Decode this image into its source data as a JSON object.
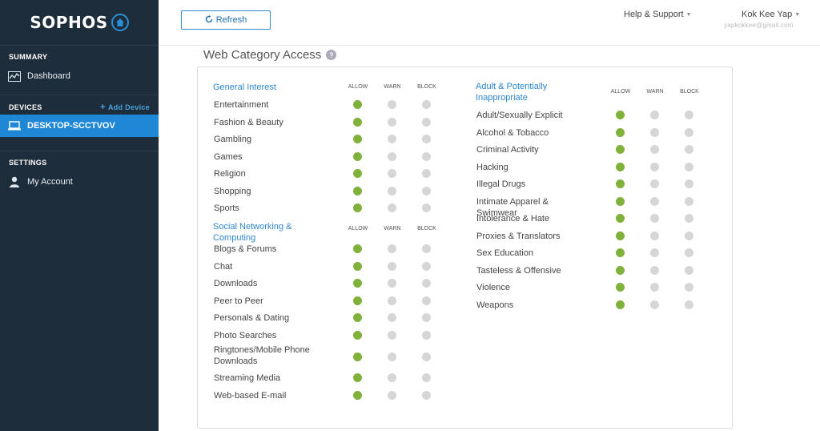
{
  "brand": {
    "name": "SOPHOS"
  },
  "sidebar": {
    "summary_heading": "SUMMARY",
    "dashboard": "Dashboard",
    "devices_heading": "DEVICES",
    "add_device": "Add Device",
    "device": "DESKTOP-SCCTVOV",
    "settings_heading": "SETTINGS",
    "my_account": "My Account"
  },
  "header": {
    "refresh": "Refresh",
    "help": "Help & Support",
    "user": "Kok Kee Yap",
    "email": "yapkokkee@gmail.com"
  },
  "page": {
    "title": "Web Category Access"
  },
  "columns": {
    "allow": "ALLOW",
    "warn": "WARN",
    "block": "BLOCK"
  },
  "groups": [
    {
      "title": "General Interest",
      "items": [
        {
          "label": "Entertainment",
          "setting": "allow"
        },
        {
          "label": "Fashion & Beauty",
          "setting": "allow"
        },
        {
          "label": "Gambling",
          "setting": "allow"
        },
        {
          "label": "Games",
          "setting": "allow"
        },
        {
          "label": "Religion",
          "setting": "allow"
        },
        {
          "label": "Shopping",
          "setting": "allow"
        },
        {
          "label": "Sports",
          "setting": "allow"
        }
      ]
    },
    {
      "title": "Social Networking & Computing",
      "items": [
        {
          "label": "Blogs & Forums",
          "setting": "allow"
        },
        {
          "label": "Chat",
          "setting": "allow"
        },
        {
          "label": "Downloads",
          "setting": "allow"
        },
        {
          "label": "Peer to Peer",
          "setting": "allow"
        },
        {
          "label": "Personals & Dating",
          "setting": "allow"
        },
        {
          "label": "Photo Searches",
          "setting": "allow"
        },
        {
          "label": "Ringtones/Mobile Phone Downloads",
          "setting": "allow"
        },
        {
          "label": "Streaming Media",
          "setting": "allow"
        },
        {
          "label": "Web-based E-mail",
          "setting": "allow"
        }
      ]
    },
    {
      "title": "Adult & Potentially Inappropriate",
      "items": [
        {
          "label": "Adult/Sexually Explicit",
          "setting": "allow"
        },
        {
          "label": "Alcohol & Tobacco",
          "setting": "allow"
        },
        {
          "label": "Criminal Activity",
          "setting": "allow"
        },
        {
          "label": "Hacking",
          "setting": "allow"
        },
        {
          "label": "Illegal Drugs",
          "setting": "allow"
        },
        {
          "label": "Intimate Apparel & Swimwear",
          "setting": "allow"
        },
        {
          "label": "Intolerance & Hate",
          "setting": "allow"
        },
        {
          "label": "Proxies & Translators",
          "setting": "allow"
        },
        {
          "label": "Sex Education",
          "setting": "allow"
        },
        {
          "label": "Tasteless & Offensive",
          "setting": "allow"
        },
        {
          "label": "Violence",
          "setting": "allow"
        },
        {
          "label": "Weapons",
          "setting": "allow"
        }
      ]
    }
  ],
  "colors": {
    "sidebar": "#1d2d3b",
    "active": "#1e87d6",
    "allow_on": "#7fb13b",
    "off": "#d6d6d6",
    "link": "#2f86cf"
  },
  "icons": {
    "logo": "shield-home-icon",
    "dashboard": "chart-icon",
    "device": "laptop-icon",
    "account": "person-icon",
    "refresh": "refresh-icon",
    "help": "question-icon"
  }
}
